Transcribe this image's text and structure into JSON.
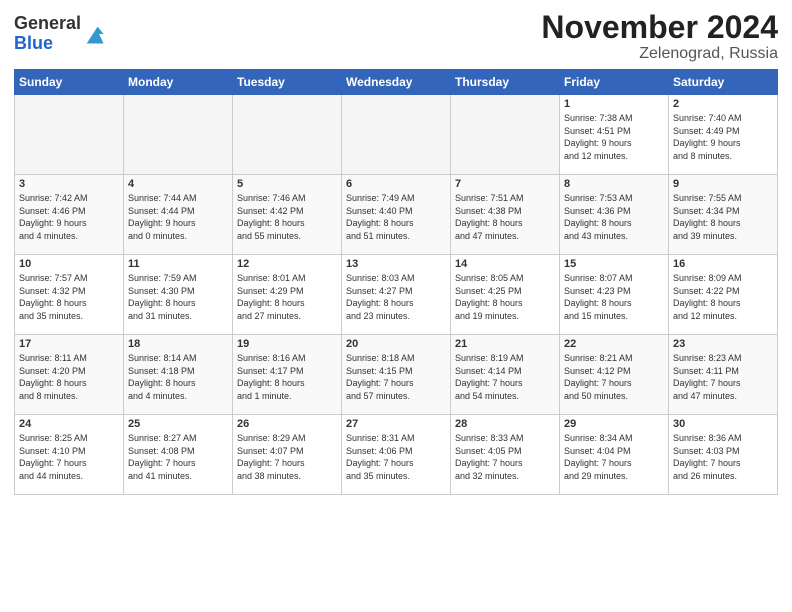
{
  "header": {
    "logo_general": "General",
    "logo_blue": "Blue",
    "month_title": "November 2024",
    "location": "Zelenograd, Russia"
  },
  "weekdays": [
    "Sunday",
    "Monday",
    "Tuesday",
    "Wednesday",
    "Thursday",
    "Friday",
    "Saturday"
  ],
  "weeks": [
    [
      {
        "day": "",
        "info": ""
      },
      {
        "day": "",
        "info": ""
      },
      {
        "day": "",
        "info": ""
      },
      {
        "day": "",
        "info": ""
      },
      {
        "day": "",
        "info": ""
      },
      {
        "day": "1",
        "info": "Sunrise: 7:38 AM\nSunset: 4:51 PM\nDaylight: 9 hours\nand 12 minutes."
      },
      {
        "day": "2",
        "info": "Sunrise: 7:40 AM\nSunset: 4:49 PM\nDaylight: 9 hours\nand 8 minutes."
      }
    ],
    [
      {
        "day": "3",
        "info": "Sunrise: 7:42 AM\nSunset: 4:46 PM\nDaylight: 9 hours\nand 4 minutes."
      },
      {
        "day": "4",
        "info": "Sunrise: 7:44 AM\nSunset: 4:44 PM\nDaylight: 9 hours\nand 0 minutes."
      },
      {
        "day": "5",
        "info": "Sunrise: 7:46 AM\nSunset: 4:42 PM\nDaylight: 8 hours\nand 55 minutes."
      },
      {
        "day": "6",
        "info": "Sunrise: 7:49 AM\nSunset: 4:40 PM\nDaylight: 8 hours\nand 51 minutes."
      },
      {
        "day": "7",
        "info": "Sunrise: 7:51 AM\nSunset: 4:38 PM\nDaylight: 8 hours\nand 47 minutes."
      },
      {
        "day": "8",
        "info": "Sunrise: 7:53 AM\nSunset: 4:36 PM\nDaylight: 8 hours\nand 43 minutes."
      },
      {
        "day": "9",
        "info": "Sunrise: 7:55 AM\nSunset: 4:34 PM\nDaylight: 8 hours\nand 39 minutes."
      }
    ],
    [
      {
        "day": "10",
        "info": "Sunrise: 7:57 AM\nSunset: 4:32 PM\nDaylight: 8 hours\nand 35 minutes."
      },
      {
        "day": "11",
        "info": "Sunrise: 7:59 AM\nSunset: 4:30 PM\nDaylight: 8 hours\nand 31 minutes."
      },
      {
        "day": "12",
        "info": "Sunrise: 8:01 AM\nSunset: 4:29 PM\nDaylight: 8 hours\nand 27 minutes."
      },
      {
        "day": "13",
        "info": "Sunrise: 8:03 AM\nSunset: 4:27 PM\nDaylight: 8 hours\nand 23 minutes."
      },
      {
        "day": "14",
        "info": "Sunrise: 8:05 AM\nSunset: 4:25 PM\nDaylight: 8 hours\nand 19 minutes."
      },
      {
        "day": "15",
        "info": "Sunrise: 8:07 AM\nSunset: 4:23 PM\nDaylight: 8 hours\nand 15 minutes."
      },
      {
        "day": "16",
        "info": "Sunrise: 8:09 AM\nSunset: 4:22 PM\nDaylight: 8 hours\nand 12 minutes."
      }
    ],
    [
      {
        "day": "17",
        "info": "Sunrise: 8:11 AM\nSunset: 4:20 PM\nDaylight: 8 hours\nand 8 minutes."
      },
      {
        "day": "18",
        "info": "Sunrise: 8:14 AM\nSunset: 4:18 PM\nDaylight: 8 hours\nand 4 minutes."
      },
      {
        "day": "19",
        "info": "Sunrise: 8:16 AM\nSunset: 4:17 PM\nDaylight: 8 hours\nand 1 minute."
      },
      {
        "day": "20",
        "info": "Sunrise: 8:18 AM\nSunset: 4:15 PM\nDaylight: 7 hours\nand 57 minutes."
      },
      {
        "day": "21",
        "info": "Sunrise: 8:19 AM\nSunset: 4:14 PM\nDaylight: 7 hours\nand 54 minutes."
      },
      {
        "day": "22",
        "info": "Sunrise: 8:21 AM\nSunset: 4:12 PM\nDaylight: 7 hours\nand 50 minutes."
      },
      {
        "day": "23",
        "info": "Sunrise: 8:23 AM\nSunset: 4:11 PM\nDaylight: 7 hours\nand 47 minutes."
      }
    ],
    [
      {
        "day": "24",
        "info": "Sunrise: 8:25 AM\nSunset: 4:10 PM\nDaylight: 7 hours\nand 44 minutes."
      },
      {
        "day": "25",
        "info": "Sunrise: 8:27 AM\nSunset: 4:08 PM\nDaylight: 7 hours\nand 41 minutes."
      },
      {
        "day": "26",
        "info": "Sunrise: 8:29 AM\nSunset: 4:07 PM\nDaylight: 7 hours\nand 38 minutes."
      },
      {
        "day": "27",
        "info": "Sunrise: 8:31 AM\nSunset: 4:06 PM\nDaylight: 7 hours\nand 35 minutes."
      },
      {
        "day": "28",
        "info": "Sunrise: 8:33 AM\nSunset: 4:05 PM\nDaylight: 7 hours\nand 32 minutes."
      },
      {
        "day": "29",
        "info": "Sunrise: 8:34 AM\nSunset: 4:04 PM\nDaylight: 7 hours\nand 29 minutes."
      },
      {
        "day": "30",
        "info": "Sunrise: 8:36 AM\nSunset: 4:03 PM\nDaylight: 7 hours\nand 26 minutes."
      }
    ]
  ]
}
